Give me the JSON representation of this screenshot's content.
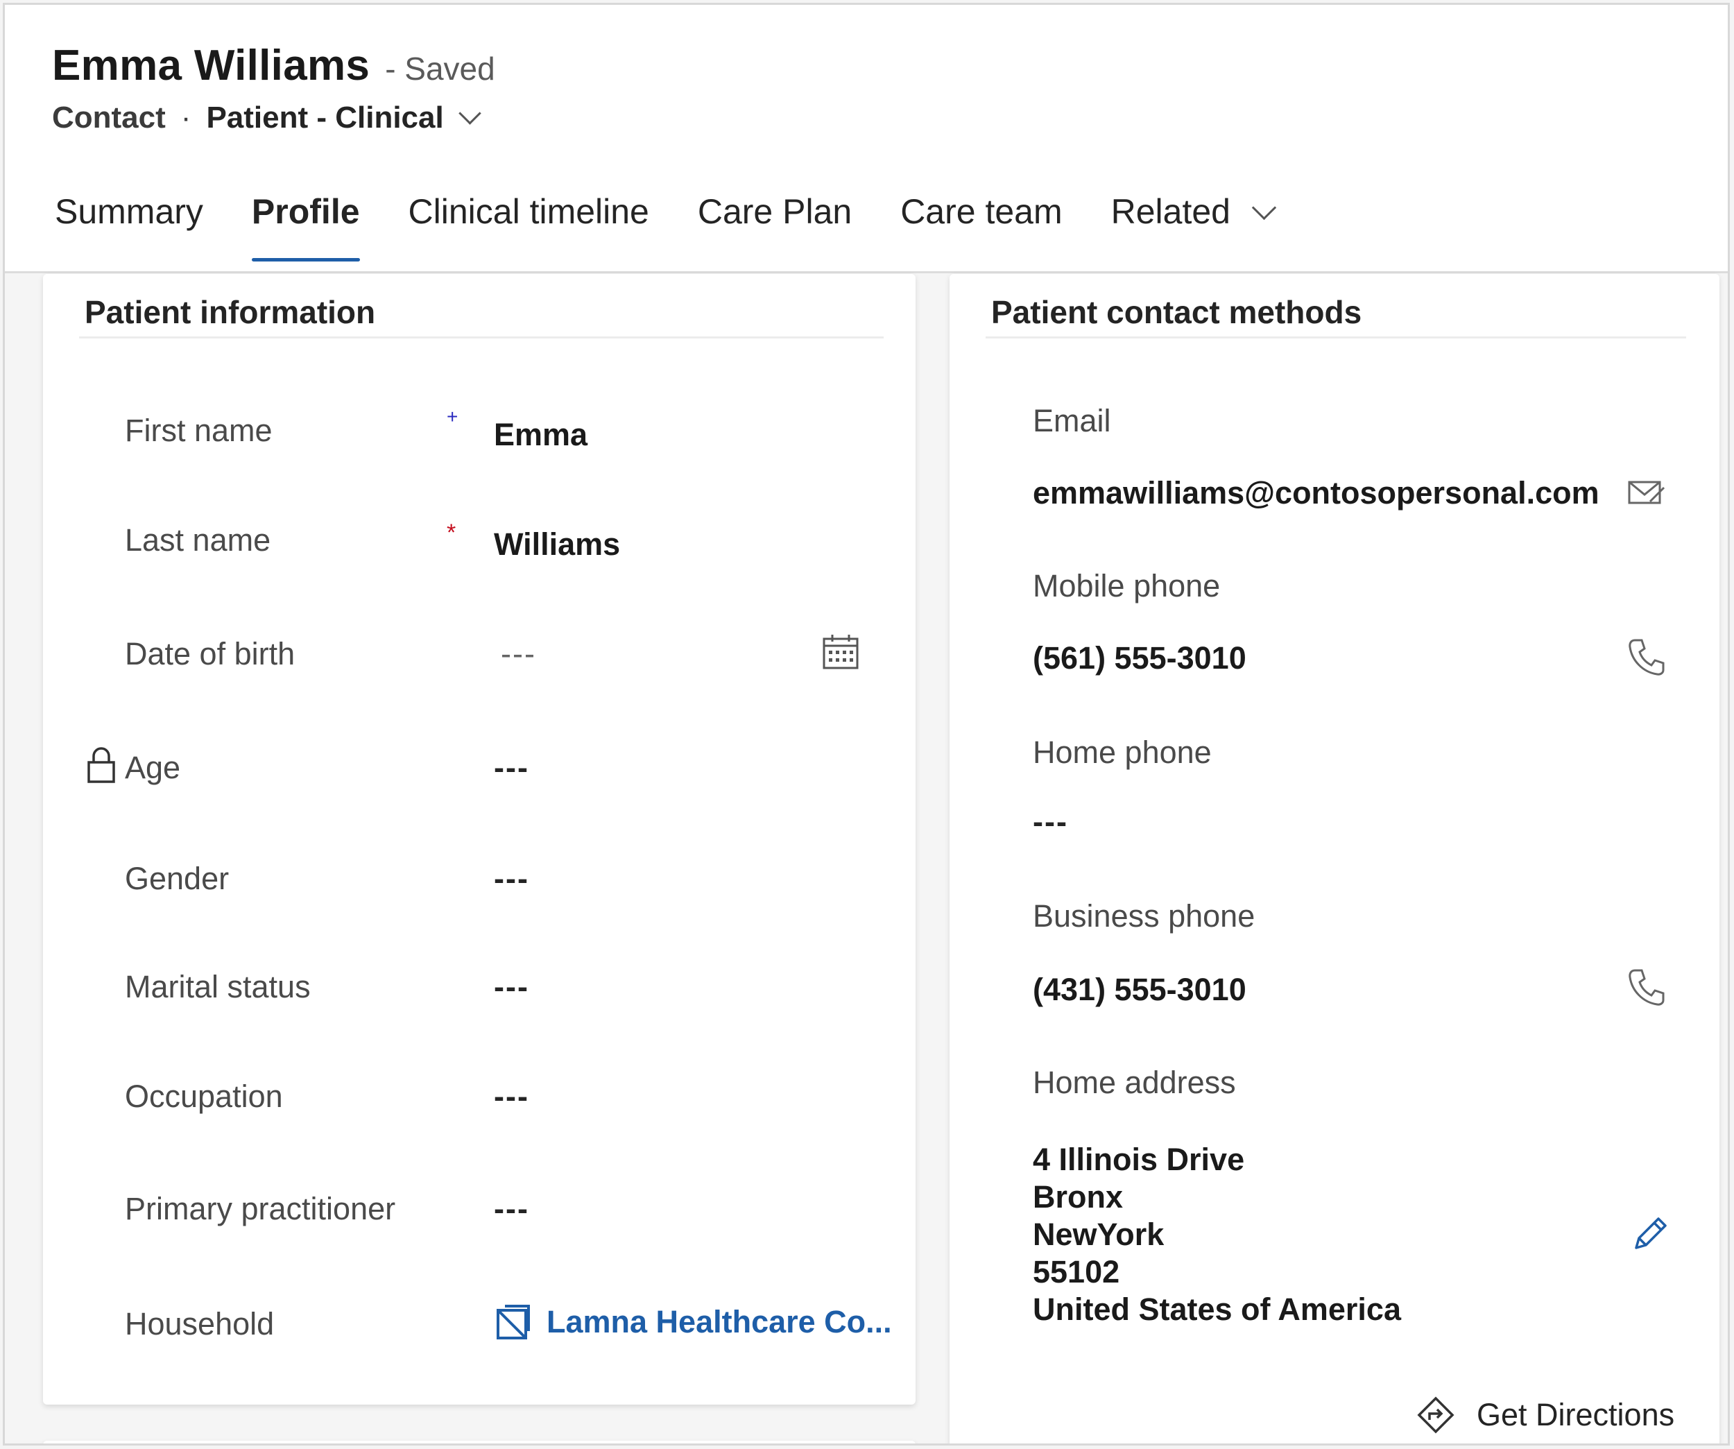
{
  "record": {
    "title": "Emma Williams",
    "status": "- Saved",
    "entity": "Contact",
    "separator": "·",
    "form_name": "Patient - Clinical"
  },
  "tabs": [
    {
      "label": "Summary"
    },
    {
      "label": "Profile"
    },
    {
      "label": "Clinical timeline"
    },
    {
      "label": "Care Plan"
    },
    {
      "label": "Care team"
    },
    {
      "label": "Related"
    }
  ],
  "active_tab": "Profile",
  "accent_color": "#1e5ea8",
  "required_color": "#c50f1f",
  "recommended_color": "#2b2bbf",
  "patient_info": {
    "title": "Patient information",
    "fields": {
      "first_name": {
        "label": "First name",
        "value": "Emma",
        "marker": "+"
      },
      "last_name": {
        "label": "Last name",
        "value": "Williams",
        "marker": "*"
      },
      "dob": {
        "label": "Date of birth",
        "value": "---"
      },
      "age": {
        "label": "Age",
        "value": "---"
      },
      "gender": {
        "label": "Gender",
        "value": "---"
      },
      "marital": {
        "label": "Marital status",
        "value": "---"
      },
      "occupation": {
        "label": "Occupation",
        "value": "---"
      },
      "practitioner": {
        "label": "Primary practitioner",
        "value": "---"
      },
      "household": {
        "label": "Household",
        "value": "Lamna Healthcare Co..."
      }
    }
  },
  "contact_methods": {
    "title": "Patient contact methods",
    "fields": {
      "email": {
        "label": "Email",
        "value": "emmawilliams@contosopersonal.com"
      },
      "mobile": {
        "label": "Mobile phone",
        "value": "(561) 555-3010"
      },
      "home_phone": {
        "label": "Home phone",
        "value": "---"
      },
      "business": {
        "label": "Business phone",
        "value": "(431) 555-3010"
      },
      "address": {
        "label": "Home address",
        "line1": "4 Illinois Drive",
        "line2": "Bronx",
        "line3": "NewYork",
        "line4": "55102",
        "line5": "United States of America"
      }
    },
    "directions_label": "Get Directions"
  },
  "icons": [
    "chevron-down-icon",
    "calendar-icon",
    "lock-icon",
    "entity-link-icon",
    "send-email-icon",
    "phone-icon",
    "edit-pencil-icon",
    "directions-icon"
  ]
}
